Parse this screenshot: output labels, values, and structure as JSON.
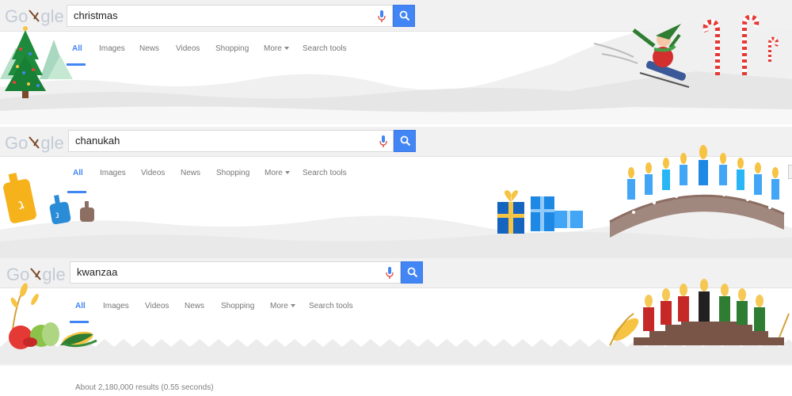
{
  "logo": {
    "text_left": "Go",
    "text_right": "gle"
  },
  "tabs": {
    "all": "All",
    "images": "Images",
    "news": "News",
    "videos": "Videos",
    "shopping": "Shopping",
    "more": "More",
    "search_tools": "Search tools"
  },
  "panels": [
    {
      "query": "christmas"
    },
    {
      "query": "chanukah"
    },
    {
      "query": "kwanzaa"
    }
  ],
  "results": {
    "stats": "About 2,180,000 results (0.55 seconds)"
  },
  "colors": {
    "accent": "#4285f4",
    "topbar": "#f1f1f1",
    "tab_text": "#777777",
    "mic_red": "#db4437"
  },
  "icons": [
    "search-icon",
    "microphone-icon",
    "christmas-tree-icon",
    "sledding-elf-icon",
    "candy-cane-icon",
    "dreidel-icon",
    "gift-icon",
    "menorah-icon",
    "kinara-icon",
    "corn-icon",
    "fruit-icon"
  ]
}
